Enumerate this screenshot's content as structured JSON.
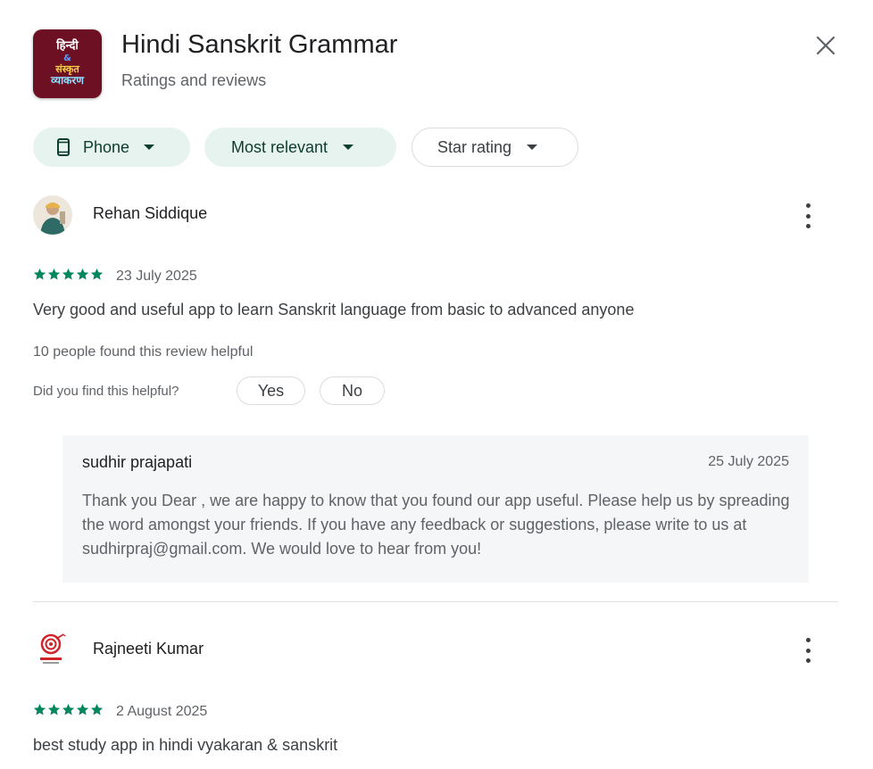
{
  "app": {
    "title": "Hindi Sanskrit Grammar",
    "subtitle": "Ratings and reviews",
    "icon_lines": [
      "हिन्दी",
      "&",
      "संस्कृत",
      "व्याकरण"
    ]
  },
  "filters": [
    {
      "label": "Phone",
      "active": true,
      "icon": "phone-icon"
    },
    {
      "label": "Most relevant",
      "active": true
    },
    {
      "label": "Star rating",
      "active": false
    }
  ],
  "reviews": [
    {
      "name": "Rehan Siddique",
      "rating": 5,
      "date": "23 July 2025",
      "text": "Very good and useful app to learn Sanskrit language from basic to advanced anyone",
      "helpful_count_text": "10 people found this review helpful",
      "helpful_question": "Did you find this helpful?",
      "yes_label": "Yes",
      "no_label": "No",
      "reply": {
        "author": "sudhir prajapati",
        "date": "25 July 2025",
        "text": "Thank you Dear , we are happy to know that you found our app useful. Please help us by spreading the word amongst your friends. If you have any feedback or suggestions, please write to us at sudhirpraj@gmail.com. We would love to hear from you!"
      }
    },
    {
      "name": "Rajneeti Kumar",
      "rating": 5,
      "date": "2 August 2025",
      "text": "best study app in hindi vyakaran & sanskrit"
    }
  ],
  "colors": {
    "star": "#01875f",
    "chip_active_bg": "#e6f3ef",
    "chip_active_text": "#0d3d2f",
    "app_icon_bg": "#6e1023"
  }
}
